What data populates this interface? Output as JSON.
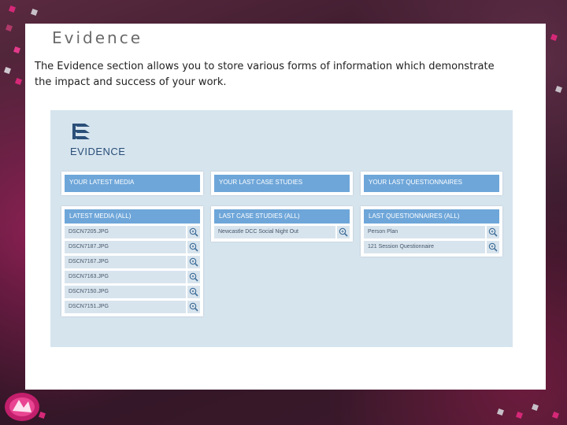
{
  "slide": {
    "title": "Evidence",
    "intro": "The Evidence section allows you to store various forms of information which demonstrate the impact and success of your work."
  },
  "app": {
    "logo_text": "EVIDENCE",
    "buttons": [
      {
        "label": "YOUR LATEST MEDIA"
      },
      {
        "label": "YOUR LAST CASE STUDIES"
      },
      {
        "label": "YOUR LAST QUESTIONNAIRES"
      }
    ],
    "lists": [
      {
        "header": "LATEST MEDIA (ALL)",
        "items": [
          "DSCN7205.JPG",
          "DSCN7187.JPG",
          "DSCN7167.JPG",
          "DSCN7163.JPG",
          "DSCN7150.JPG",
          "DSCN7151.JPG"
        ]
      },
      {
        "header": "LAST CASE STUDIES (ALL)",
        "items": [
          "Newcastle DCC Social Night Out"
        ]
      },
      {
        "header": "LAST QUESTIONNAIRES (ALL)",
        "items": [
          "Person Plan",
          "121 Session Questionnaire"
        ]
      }
    ]
  },
  "colors": {
    "accent_blue": "#6ea6d9",
    "panel_bg": "#d6e4ee",
    "row_bg": "#d8e4ed",
    "decor_pink": "#d62878"
  },
  "icons": {
    "logo": "stacked-layers-icon",
    "row_action": "zoom-in-icon"
  }
}
